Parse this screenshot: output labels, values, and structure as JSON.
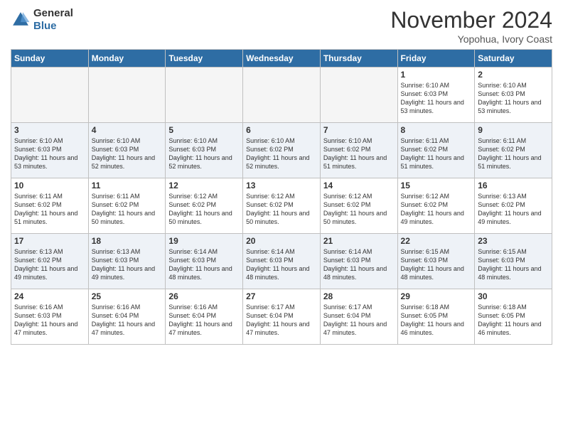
{
  "header": {
    "logo_general": "General",
    "logo_blue": "Blue",
    "month": "November 2024",
    "location": "Yopohua, Ivory Coast"
  },
  "weekdays": [
    "Sunday",
    "Monday",
    "Tuesday",
    "Wednesday",
    "Thursday",
    "Friday",
    "Saturday"
  ],
  "weeks": [
    {
      "alt": false,
      "days": [
        {
          "date": "",
          "empty": true
        },
        {
          "date": "",
          "empty": true
        },
        {
          "date": "",
          "empty": true
        },
        {
          "date": "",
          "empty": true
        },
        {
          "date": "",
          "empty": true
        },
        {
          "date": "1",
          "sunrise": "Sunrise: 6:10 AM",
          "sunset": "Sunset: 6:03 PM",
          "daylight": "Daylight: 11 hours and 53 minutes."
        },
        {
          "date": "2",
          "sunrise": "Sunrise: 6:10 AM",
          "sunset": "Sunset: 6:03 PM",
          "daylight": "Daylight: 11 hours and 53 minutes."
        }
      ]
    },
    {
      "alt": true,
      "days": [
        {
          "date": "3",
          "sunrise": "Sunrise: 6:10 AM",
          "sunset": "Sunset: 6:03 PM",
          "daylight": "Daylight: 11 hours and 53 minutes."
        },
        {
          "date": "4",
          "sunrise": "Sunrise: 6:10 AM",
          "sunset": "Sunset: 6:03 PM",
          "daylight": "Daylight: 11 hours and 52 minutes."
        },
        {
          "date": "5",
          "sunrise": "Sunrise: 6:10 AM",
          "sunset": "Sunset: 6:03 PM",
          "daylight": "Daylight: 11 hours and 52 minutes."
        },
        {
          "date": "6",
          "sunrise": "Sunrise: 6:10 AM",
          "sunset": "Sunset: 6:02 PM",
          "daylight": "Daylight: 11 hours and 52 minutes."
        },
        {
          "date": "7",
          "sunrise": "Sunrise: 6:10 AM",
          "sunset": "Sunset: 6:02 PM",
          "daylight": "Daylight: 11 hours and 51 minutes."
        },
        {
          "date": "8",
          "sunrise": "Sunrise: 6:11 AM",
          "sunset": "Sunset: 6:02 PM",
          "daylight": "Daylight: 11 hours and 51 minutes."
        },
        {
          "date": "9",
          "sunrise": "Sunrise: 6:11 AM",
          "sunset": "Sunset: 6:02 PM",
          "daylight": "Daylight: 11 hours and 51 minutes."
        }
      ]
    },
    {
      "alt": false,
      "days": [
        {
          "date": "10",
          "sunrise": "Sunrise: 6:11 AM",
          "sunset": "Sunset: 6:02 PM",
          "daylight": "Daylight: 11 hours and 51 minutes."
        },
        {
          "date": "11",
          "sunrise": "Sunrise: 6:11 AM",
          "sunset": "Sunset: 6:02 PM",
          "daylight": "Daylight: 11 hours and 50 minutes."
        },
        {
          "date": "12",
          "sunrise": "Sunrise: 6:12 AM",
          "sunset": "Sunset: 6:02 PM",
          "daylight": "Daylight: 11 hours and 50 minutes."
        },
        {
          "date": "13",
          "sunrise": "Sunrise: 6:12 AM",
          "sunset": "Sunset: 6:02 PM",
          "daylight": "Daylight: 11 hours and 50 minutes."
        },
        {
          "date": "14",
          "sunrise": "Sunrise: 6:12 AM",
          "sunset": "Sunset: 6:02 PM",
          "daylight": "Daylight: 11 hours and 50 minutes."
        },
        {
          "date": "15",
          "sunrise": "Sunrise: 6:12 AM",
          "sunset": "Sunset: 6:02 PM",
          "daylight": "Daylight: 11 hours and 49 minutes."
        },
        {
          "date": "16",
          "sunrise": "Sunrise: 6:13 AM",
          "sunset": "Sunset: 6:02 PM",
          "daylight": "Daylight: 11 hours and 49 minutes."
        }
      ]
    },
    {
      "alt": true,
      "days": [
        {
          "date": "17",
          "sunrise": "Sunrise: 6:13 AM",
          "sunset": "Sunset: 6:02 PM",
          "daylight": "Daylight: 11 hours and 49 minutes."
        },
        {
          "date": "18",
          "sunrise": "Sunrise: 6:13 AM",
          "sunset": "Sunset: 6:03 PM",
          "daylight": "Daylight: 11 hours and 49 minutes."
        },
        {
          "date": "19",
          "sunrise": "Sunrise: 6:14 AM",
          "sunset": "Sunset: 6:03 PM",
          "daylight": "Daylight: 11 hours and 48 minutes."
        },
        {
          "date": "20",
          "sunrise": "Sunrise: 6:14 AM",
          "sunset": "Sunset: 6:03 PM",
          "daylight": "Daylight: 11 hours and 48 minutes."
        },
        {
          "date": "21",
          "sunrise": "Sunrise: 6:14 AM",
          "sunset": "Sunset: 6:03 PM",
          "daylight": "Daylight: 11 hours and 48 minutes."
        },
        {
          "date": "22",
          "sunrise": "Sunrise: 6:15 AM",
          "sunset": "Sunset: 6:03 PM",
          "daylight": "Daylight: 11 hours and 48 minutes."
        },
        {
          "date": "23",
          "sunrise": "Sunrise: 6:15 AM",
          "sunset": "Sunset: 6:03 PM",
          "daylight": "Daylight: 11 hours and 48 minutes."
        }
      ]
    },
    {
      "alt": false,
      "days": [
        {
          "date": "24",
          "sunrise": "Sunrise: 6:16 AM",
          "sunset": "Sunset: 6:03 PM",
          "daylight": "Daylight: 11 hours and 47 minutes."
        },
        {
          "date": "25",
          "sunrise": "Sunrise: 6:16 AM",
          "sunset": "Sunset: 6:04 PM",
          "daylight": "Daylight: 11 hours and 47 minutes."
        },
        {
          "date": "26",
          "sunrise": "Sunrise: 6:16 AM",
          "sunset": "Sunset: 6:04 PM",
          "daylight": "Daylight: 11 hours and 47 minutes."
        },
        {
          "date": "27",
          "sunrise": "Sunrise: 6:17 AM",
          "sunset": "Sunset: 6:04 PM",
          "daylight": "Daylight: 11 hours and 47 minutes."
        },
        {
          "date": "28",
          "sunrise": "Sunrise: 6:17 AM",
          "sunset": "Sunset: 6:04 PM",
          "daylight": "Daylight: 11 hours and 47 minutes."
        },
        {
          "date": "29",
          "sunrise": "Sunrise: 6:18 AM",
          "sunset": "Sunset: 6:05 PM",
          "daylight": "Daylight: 11 hours and 46 minutes."
        },
        {
          "date": "30",
          "sunrise": "Sunrise: 6:18 AM",
          "sunset": "Sunset: 6:05 PM",
          "daylight": "Daylight: 11 hours and 46 minutes."
        }
      ]
    }
  ]
}
